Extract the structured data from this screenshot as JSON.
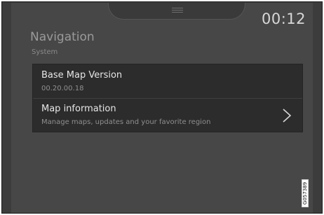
{
  "status_bar": {
    "time": "00:12"
  },
  "page": {
    "title": "Navigation",
    "subtitle": "System"
  },
  "list": {
    "items": [
      {
        "title": "Base Map Version",
        "subtitle": "00.20.00.18"
      },
      {
        "title": "Map information",
        "subtitle": "Manage maps, updates and your favorite region",
        "icon": "chevron-right-icon"
      }
    ]
  },
  "figure_code": "G057389",
  "colors": {
    "screen_background": "#474747",
    "list_background": "#2c2c2c",
    "primary_text": "#e6e6e6",
    "secondary_text": "#8f8f8f"
  }
}
